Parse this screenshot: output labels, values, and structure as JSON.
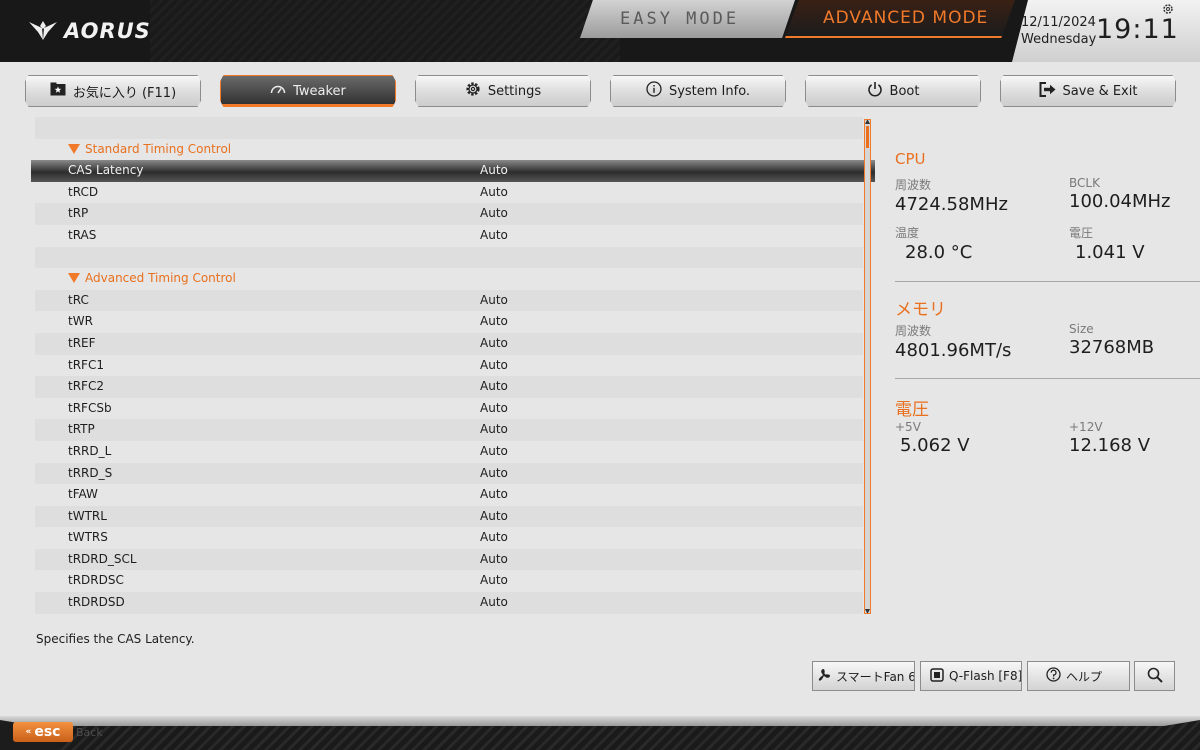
{
  "header": {
    "brand": "AORUS",
    "easy_mode": "EASY MODE",
    "advanced_mode": "ADVANCED MODE",
    "date": "12/11/2024",
    "weekday": "Wednesday",
    "time": "19:11"
  },
  "tabs": [
    {
      "label": "お気に入り (F11)",
      "icon": "star-folder-icon"
    },
    {
      "label": "Tweaker",
      "icon": "speedometer-icon",
      "active": true
    },
    {
      "label": "Settings",
      "icon": "gear-icon"
    },
    {
      "label": "System Info.",
      "icon": "info-icon"
    },
    {
      "label": "Boot",
      "icon": "power-icon"
    },
    {
      "label": "Save & Exit",
      "icon": "exit-icon"
    }
  ],
  "list": {
    "rows": [
      {
        "type": "blank"
      },
      {
        "type": "section",
        "label": "Standard Timing Control"
      },
      {
        "type": "item",
        "label": "CAS Latency",
        "value": "Auto",
        "selected": true
      },
      {
        "type": "item",
        "label": "tRCD",
        "value": "Auto"
      },
      {
        "type": "item",
        "label": "tRP",
        "value": "Auto"
      },
      {
        "type": "item",
        "label": "tRAS",
        "value": "Auto"
      },
      {
        "type": "blank"
      },
      {
        "type": "section",
        "label": "Advanced Timing Control"
      },
      {
        "type": "item",
        "label": "tRC",
        "value": "Auto"
      },
      {
        "type": "item",
        "label": "tWR",
        "value": "Auto"
      },
      {
        "type": "item",
        "label": "tREF",
        "value": "Auto"
      },
      {
        "type": "item",
        "label": "tRFC1",
        "value": "Auto"
      },
      {
        "type": "item",
        "label": "tRFC2",
        "value": "Auto"
      },
      {
        "type": "item",
        "label": "tRFCSb",
        "value": "Auto"
      },
      {
        "type": "item",
        "label": "tRTP",
        "value": "Auto"
      },
      {
        "type": "item",
        "label": "tRRD_L",
        "value": "Auto"
      },
      {
        "type": "item",
        "label": "tRRD_S",
        "value": "Auto"
      },
      {
        "type": "item",
        "label": "tFAW",
        "value": "Auto"
      },
      {
        "type": "item",
        "label": "tWTRL",
        "value": "Auto"
      },
      {
        "type": "item",
        "label": "tWTRS",
        "value": "Auto"
      },
      {
        "type": "item",
        "label": "tRDRD_SCL",
        "value": "Auto"
      },
      {
        "type": "item",
        "label": "tRDRDSC",
        "value": "Auto"
      },
      {
        "type": "item",
        "label": "tRDRDSD",
        "value": "Auto"
      }
    ]
  },
  "info": {
    "cpu": {
      "title": "CPU",
      "freq_label": "周波数",
      "freq_value": "4724.58MHz",
      "bclk_label": "BCLK",
      "bclk_value": "100.04MHz",
      "temp_label": "温度",
      "temp_value": "28.0 °C",
      "volt_label": "電圧",
      "volt_value": "1.041 V"
    },
    "memory": {
      "title": "メモリ",
      "freq_label": "周波数",
      "freq_value": "4801.96MT/s",
      "size_label": "Size",
      "size_value": "32768MB"
    },
    "voltage": {
      "title": "電圧",
      "v5_label": "+5V",
      "v5_value": "5.062 V",
      "v12_label": "+12V",
      "v12_value": "12.168 V"
    }
  },
  "footer": {
    "help_text": "Specifies the CAS Latency.",
    "smart_fan": "スマートFan 6 [F",
    "qflash": "Q-Flash [F8]",
    "help": "ヘルプ",
    "esc": "esc",
    "back": "Back"
  },
  "colors": {
    "accent": "#f07a2a",
    "bg": "#e6e6e6"
  }
}
